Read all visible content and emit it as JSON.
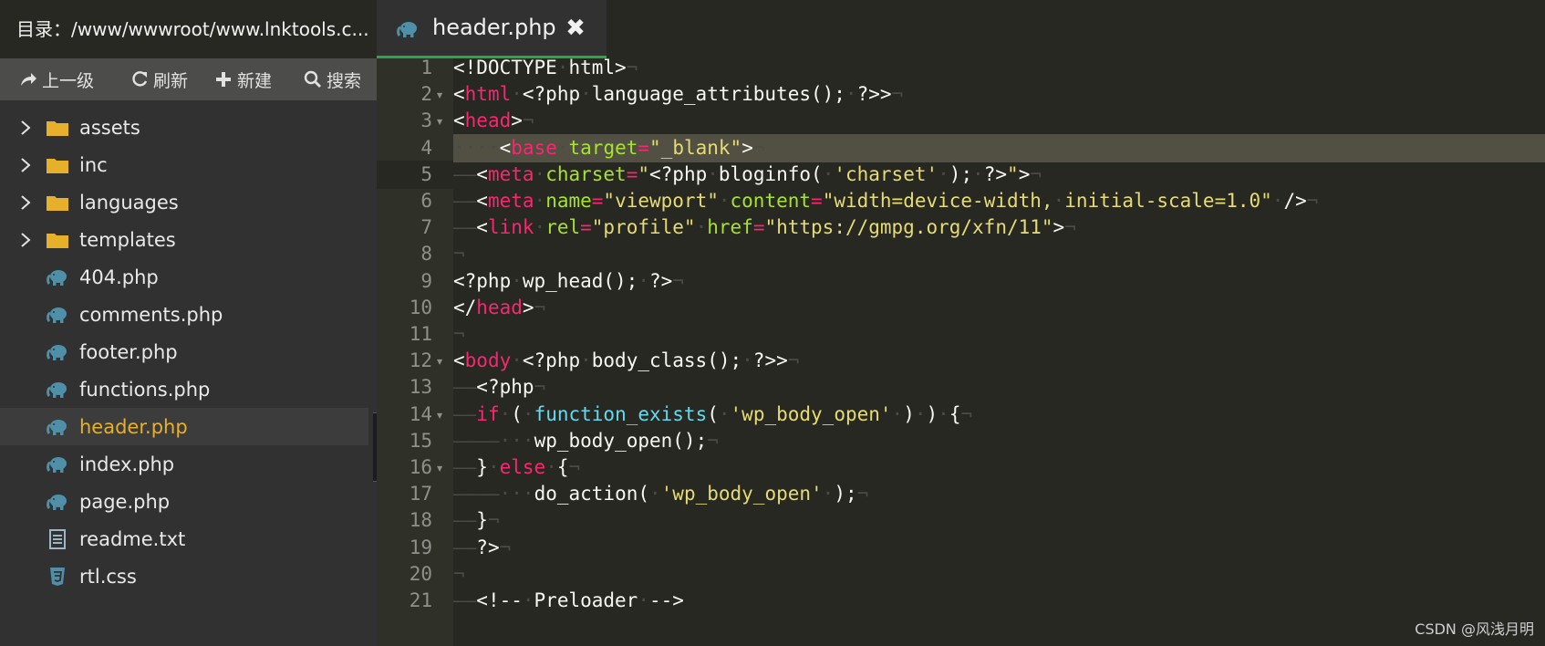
{
  "sidebar": {
    "directory": "目录：/www/wwwroot/www.lnktools.c...",
    "toolbar": {
      "up": "上一级",
      "refresh": "刷新",
      "new": "新建",
      "search": "搜索"
    },
    "items": [
      {
        "name": "assets",
        "type": "folder"
      },
      {
        "name": "inc",
        "type": "folder"
      },
      {
        "name": "languages",
        "type": "folder"
      },
      {
        "name": "templates",
        "type": "folder"
      },
      {
        "name": "404.php",
        "type": "php"
      },
      {
        "name": "comments.php",
        "type": "php"
      },
      {
        "name": "footer.php",
        "type": "php"
      },
      {
        "name": "functions.php",
        "type": "php"
      },
      {
        "name": "header.php",
        "type": "php",
        "active": true
      },
      {
        "name": "index.php",
        "type": "php"
      },
      {
        "name": "page.php",
        "type": "php"
      },
      {
        "name": "readme.txt",
        "type": "txt"
      },
      {
        "name": "rtl.css",
        "type": "css"
      }
    ]
  },
  "tab": {
    "name": "header.php",
    "close": "✖"
  },
  "editor": {
    "lines": [
      "1",
      "2",
      "3",
      "4",
      "5",
      "6",
      "7",
      "8",
      "9",
      "10",
      "11",
      "12",
      "13",
      "14",
      "15",
      "16",
      "17",
      "18",
      "19",
      "20",
      "21"
    ]
  },
  "watermark": "CSDN @风浅月明",
  "colors": {
    "accent_green": "#2fa548",
    "active_file": "#e7b02a",
    "tag": "#f92672",
    "attr": "#a6e22e",
    "string": "#e6db74",
    "func": "#66d9ef"
  }
}
